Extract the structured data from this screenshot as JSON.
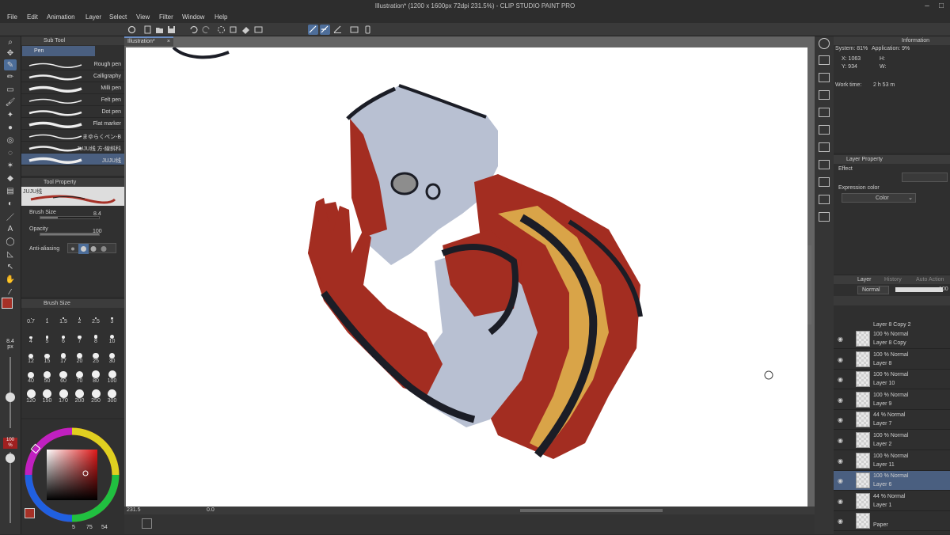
{
  "window": {
    "title": "Illustration* (1200 x 1600px 72dpi 231.5%) - CLIP STUDIO PAINT PRO"
  },
  "menu": [
    "File",
    "Edit",
    "Animation",
    "Layer",
    "Select",
    "View",
    "Filter",
    "Window",
    "Help"
  ],
  "subtool": {
    "header": "Sub Tool",
    "group": "Pen",
    "brushes": [
      "Rough pen",
      "Calligraphy",
      "Milli pen",
      "Felt pen",
      "Dot pen",
      "Flat marker",
      "まゆらくペン-B",
      "JUJU线 方-線斜科",
      "JUJU线"
    ]
  },
  "tool_property": {
    "header": "Tool Property",
    "preview_name": "JUJU线",
    "brush_size_label": "Brush Size",
    "brush_size_value": "8.4",
    "opacity_label": "Opacity",
    "opacity_value": "100",
    "antialias_label": "Anti-aliasing"
  },
  "brush_size_panel": {
    "header": "Brush Size",
    "sizes": [
      "0.7",
      "1",
      "1.5",
      "2",
      "2.5",
      "3",
      "4",
      "5",
      "6",
      "7",
      "8",
      "10",
      "12",
      "15",
      "17",
      "20",
      "25",
      "30",
      "40",
      "50",
      "60",
      "70",
      "80",
      "100",
      "120",
      "150",
      "170",
      "200",
      "250",
      "300"
    ]
  },
  "side_readout": {
    "size": "8.4",
    "unit": "px",
    "opacity": "100",
    "opacity_unit": "%"
  },
  "color": {
    "main": "#a63127",
    "sub": "#111111",
    "hsv_h": "5",
    "hsv_s": "75",
    "hsv_v": "54"
  },
  "canvas": {
    "tab": "Illustration*",
    "zoom": "231.5",
    "angle": "0.0"
  },
  "info": {
    "header": "Information",
    "system": "System: 81%",
    "application": "Application:  9%",
    "x": "X: 1063",
    "y": "Y: 934",
    "h": "H:",
    "w": "W:",
    "worktime_label": "Work time:",
    "worktime_value": "2 h 53 m"
  },
  "layer_property": {
    "header": "Layer Property",
    "effect": "Effect",
    "expression_label": "Expression color",
    "expression_value": "Color"
  },
  "layer_panel": {
    "tabs": [
      "Layer",
      "History",
      "Auto Action"
    ],
    "blend_mode": "Normal",
    "opacity": "100",
    "partial_top": "Layer 8 Copy 2",
    "layers": [
      {
        "mode": "100 % Normal",
        "name": "Layer 8 Copy",
        "selected": false
      },
      {
        "mode": "100 % Normal",
        "name": "Layer 8",
        "selected": false
      },
      {
        "mode": "100 % Normal",
        "name": "Layer 10",
        "selected": false
      },
      {
        "mode": "100 % Normal",
        "name": "Layer 9",
        "selected": false
      },
      {
        "mode": "44 % Normal",
        "name": "Layer 7",
        "selected": false
      },
      {
        "mode": "100 % Normal",
        "name": "Layer 2",
        "selected": false
      },
      {
        "mode": "100 % Normal",
        "name": "Layer 11",
        "selected": false
      },
      {
        "mode": "100 % Normal",
        "name": "Layer 6",
        "selected": true
      },
      {
        "mode": "44 % Normal",
        "name": "Layer 1",
        "selected": false
      },
      {
        "mode": "",
        "name": "Paper",
        "selected": false
      }
    ]
  },
  "palette": {
    "skin": "#b8c0d2",
    "red": "#a32d21",
    "gold": "#d9a448",
    "ink": "#1b1d26",
    "shade": "#8d8d8d"
  }
}
